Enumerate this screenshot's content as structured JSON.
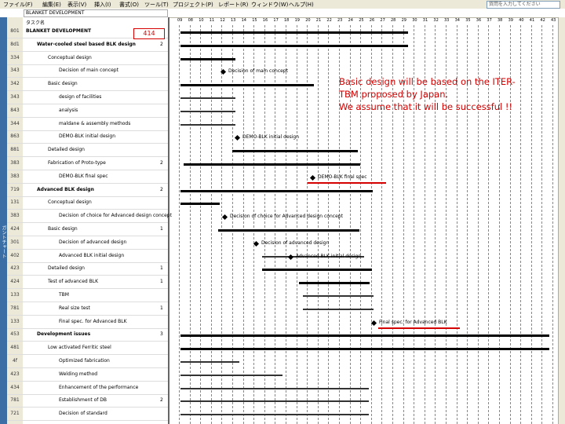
{
  "menubar": {
    "items": [
      "ファイル(F)",
      "編集(E)",
      "表示(V)",
      "挿入(I)",
      "書式(O)",
      "ツール(T)",
      "プロジェクト(P)",
      "レポート(R)",
      "ウィンドウ(W)",
      "ヘルプ(H)"
    ],
    "help_placeholder": "質問を入力してください"
  },
  "formula": {
    "value": "BLANKET DEVELOPMENT"
  },
  "columns": {
    "task_name": "タスク名"
  },
  "left_strip_label": "ガントチャート",
  "badge": "414",
  "note": {
    "line1": "Basic design will be based on the ITER-",
    "line2": "TBM proposed by Japan.",
    "line3": "We assume that it will be successful !!"
  },
  "timeline_ticks": [
    "09",
    "08",
    "10",
    "11",
    "12",
    "13",
    "14",
    "15",
    "16",
    "17",
    "18",
    "19",
    "20",
    "21",
    "22",
    "23",
    "24",
    "25",
    "26",
    "27",
    "28",
    "29",
    "30",
    "31",
    "32",
    "33",
    "34",
    "35",
    "36",
    "37",
    "38",
    "39",
    "40",
    "41",
    "42",
    "43"
  ],
  "rows": [
    {
      "num": "801",
      "task": "BLANKET DEVELOPMENT",
      "dur": "",
      "bold": true,
      "indent": 0
    },
    {
      "num": "8d1",
      "task": "Water-cooled steel based BLK design",
      "dur": "2",
      "bold": true,
      "indent": 1
    },
    {
      "num": "334",
      "task": "Conceptual design",
      "dur": "",
      "bold": false,
      "indent": 2
    },
    {
      "num": "343",
      "task": "Decision of main concept",
      "dur": "",
      "bold": false,
      "indent": 3
    },
    {
      "num": "342",
      "task": "Basic design",
      "dur": "",
      "bold": false,
      "indent": 2
    },
    {
      "num": "343",
      "task": "design of facilities",
      "dur": "",
      "bold": false,
      "indent": 3
    },
    {
      "num": "843",
      "task": "analysis",
      "dur": "",
      "bold": false,
      "indent": 3
    },
    {
      "num": "344",
      "task": "maldane & assembly methods",
      "dur": "",
      "bold": false,
      "indent": 3
    },
    {
      "num": "863",
      "task": "DEMO-BLK initial design",
      "dur": "",
      "bold": false,
      "indent": 3
    },
    {
      "num": "881",
      "task": "Detailed design",
      "dur": "",
      "bold": false,
      "indent": 2
    },
    {
      "num": "383",
      "task": "Fabrication of Proto-type",
      "dur": "2",
      "bold": false,
      "indent": 2
    },
    {
      "num": "383",
      "task": "DEMO-BLK final spec",
      "dur": "",
      "bold": false,
      "indent": 3
    },
    {
      "num": "719",
      "task": "Advanced BLK design",
      "dur": "2",
      "bold": true,
      "indent": 1
    },
    {
      "num": "131",
      "task": "Conceptual design",
      "dur": "",
      "bold": false,
      "indent": 2
    },
    {
      "num": "383",
      "task": "Decision of choice for Advanced design concept",
      "dur": "",
      "bold": false,
      "indent": 3
    },
    {
      "num": "424",
      "task": "Basic design",
      "dur": "1",
      "bold": false,
      "indent": 2
    },
    {
      "num": "301",
      "task": "Decision of advanced design",
      "dur": "",
      "bold": false,
      "indent": 3
    },
    {
      "num": "402",
      "task": "Advanced BLK initial design",
      "dur": "",
      "bold": false,
      "indent": 3
    },
    {
      "num": "423",
      "task": "Detailed design",
      "dur": "1",
      "bold": false,
      "indent": 2
    },
    {
      "num": "424",
      "task": "Test of advanced BLK",
      "dur": "1",
      "bold": false,
      "indent": 2
    },
    {
      "num": "133",
      "task": "TBM",
      "dur": "",
      "bold": false,
      "indent": 3
    },
    {
      "num": "781",
      "task": "Real size test",
      "dur": "1",
      "bold": false,
      "indent": 3
    },
    {
      "num": "133",
      "task": "Final spec. for Advanced BLK",
      "dur": "",
      "bold": false,
      "indent": 3
    },
    {
      "num": "453",
      "task": "Development issues",
      "dur": "3",
      "bold": true,
      "indent": 1
    },
    {
      "num": "481",
      "task": "Low activated Ferritic steel",
      "dur": "",
      "bold": false,
      "indent": 2
    },
    {
      "num": "4f",
      "task": "Optimized fabrication",
      "dur": "",
      "bold": false,
      "indent": 3
    },
    {
      "num": "423",
      "task": "Welding method",
      "dur": "",
      "bold": false,
      "indent": 3
    },
    {
      "num": "434",
      "task": "Enhancement of the performance",
      "dur": "",
      "bold": false,
      "indent": 3
    },
    {
      "num": "781",
      "task": "Establishment of DB",
      "dur": "2",
      "bold": false,
      "indent": 3
    },
    {
      "num": "721",
      "task": "Decision of standard",
      "dur": "",
      "bold": false,
      "indent": 3
    }
  ],
  "gantt_labels": {
    "l1": "Decision of main concept",
    "l2": "DEMO-BLK initial design",
    "l3": "DEMO-BLK final spec",
    "l4": "Decision of choice for Advanced design concept",
    "l5": "Decision of advanced design",
    "l6": "Advanced BLK initial design",
    "l7": "Final spec. for Advanced BLK"
  }
}
